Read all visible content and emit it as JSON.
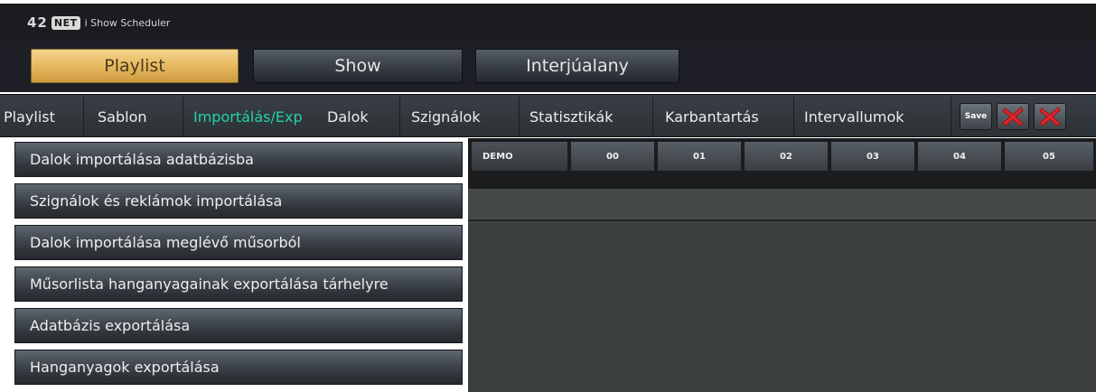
{
  "app": {
    "logo_number": "42",
    "logo_net": "NET",
    "title": "i Show Scheduler"
  },
  "main_tabs": [
    {
      "label": "Playlist",
      "active": true
    },
    {
      "label": "Show",
      "active": false
    },
    {
      "label": "Interjúalany",
      "active": false
    }
  ],
  "sub_nav": {
    "items": [
      {
        "label": "Playlist",
        "active": false
      },
      {
        "label": "Sablon",
        "active": false
      },
      {
        "label": "Importálás/Exp",
        "active": true
      },
      {
        "label": "Dalok",
        "active": false
      },
      {
        "label": "Szignálok",
        "active": false
      },
      {
        "label": "Statisztikák",
        "active": false
      },
      {
        "label": "Karbantartás",
        "active": false
      },
      {
        "label": "Intervallumok",
        "active": false
      }
    ],
    "save_label": "Save",
    "close_icon": "red-x-icon",
    "active_color": "#23d2a6"
  },
  "left_menu": [
    "Dalok importálása adatbázisba",
    "Szignálok és reklámok importálása",
    "Dalok importálása meglévő műsorból",
    "Műsorlista hanganyagainak exportálása tárhelyre",
    "Adatbázis exportálása",
    "Hanganyagok exportálása"
  ],
  "hours": {
    "demo_label": "DEMO",
    "cells": [
      "00",
      "01",
      "02",
      "03",
      "04",
      "05"
    ]
  }
}
